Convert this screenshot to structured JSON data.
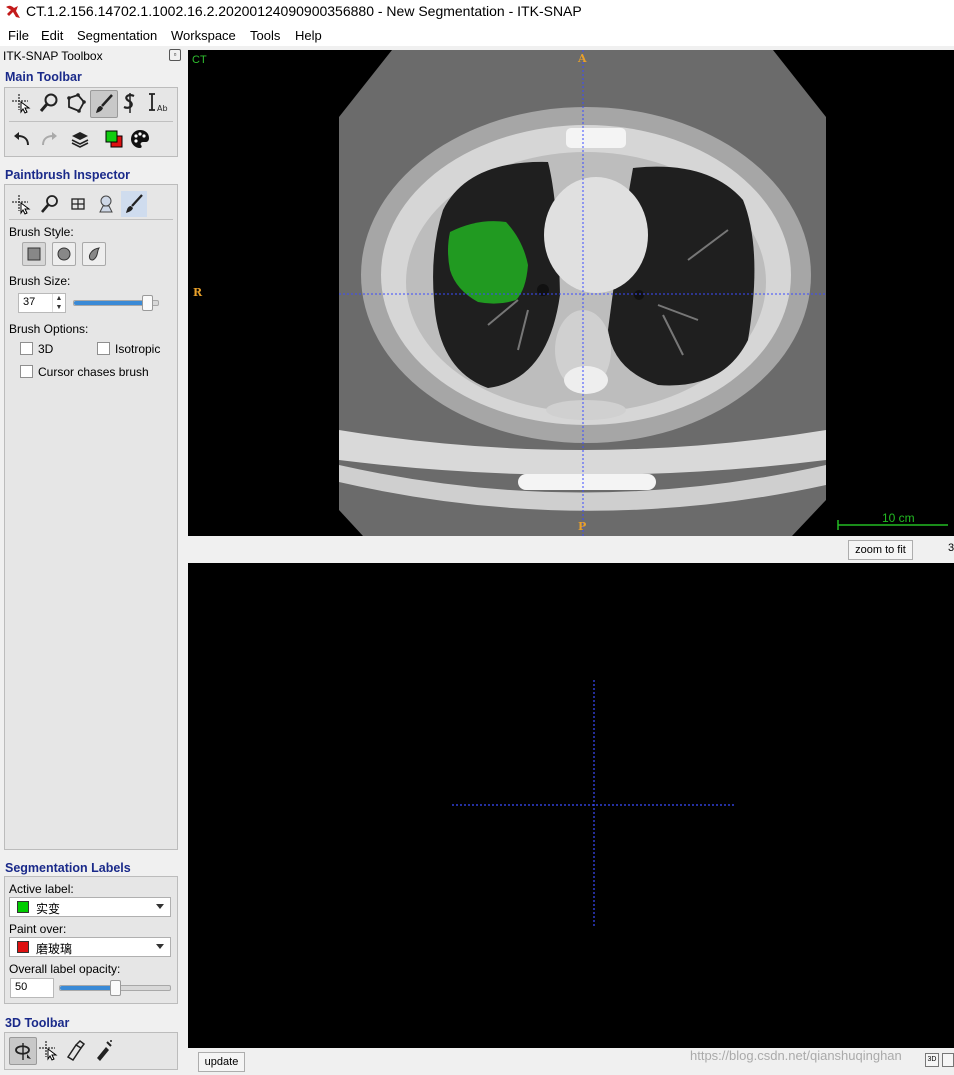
{
  "window": {
    "title": "CT.1.2.156.14702.1.1002.16.2.20200124090900356880 - New Segmentation - ITK-SNAP"
  },
  "menu": [
    "File",
    "Edit",
    "Segmentation",
    "Workspace",
    "Tools",
    "Help"
  ],
  "toolbox": {
    "title": "ITK-SNAP Toolbox",
    "main_toolbar_head": "Main Toolbar",
    "paintbrush_head": "Paintbrush Inspector",
    "brush_style_label": "Brush Style:",
    "brush_size_label": "Brush Size:",
    "brush_size_value": "37",
    "brush_size_fraction": 0.87,
    "brush_options_label": "Brush Options:",
    "opt_3d": "3D",
    "opt_isotropic": "Isotropic",
    "opt_cursor_chases": "Cursor chases brush",
    "seg_labels_head": "Segmentation Labels",
    "active_label_caption": "Active label:",
    "active_label": "实变",
    "active_label_color": "#00cc00",
    "paint_over_caption": "Paint over:",
    "paint_over": "磨玻璃",
    "paint_over_color": "#dd1111",
    "opacity_caption": "Overall label opacity:",
    "opacity_value": "50",
    "opacity_fraction": 0.5,
    "toolbar3d_head": "3D Toolbar"
  },
  "view_top": {
    "modality": "CT",
    "orient_top": "A",
    "orient_left": "R",
    "orient_bottom": "P",
    "scalebar_label": "10 cm",
    "zoom_button": "zoom to fit",
    "partial_text": "3"
  },
  "view_bottom": {
    "update_button": "update",
    "watermark": "https://blog.csdn.net/qianshuqinghan"
  },
  "colors": {
    "segmentation": "#22b022",
    "crosshair": "#3b4bff",
    "scalebar": "#22bb22",
    "orientation": "#e8a02a"
  }
}
